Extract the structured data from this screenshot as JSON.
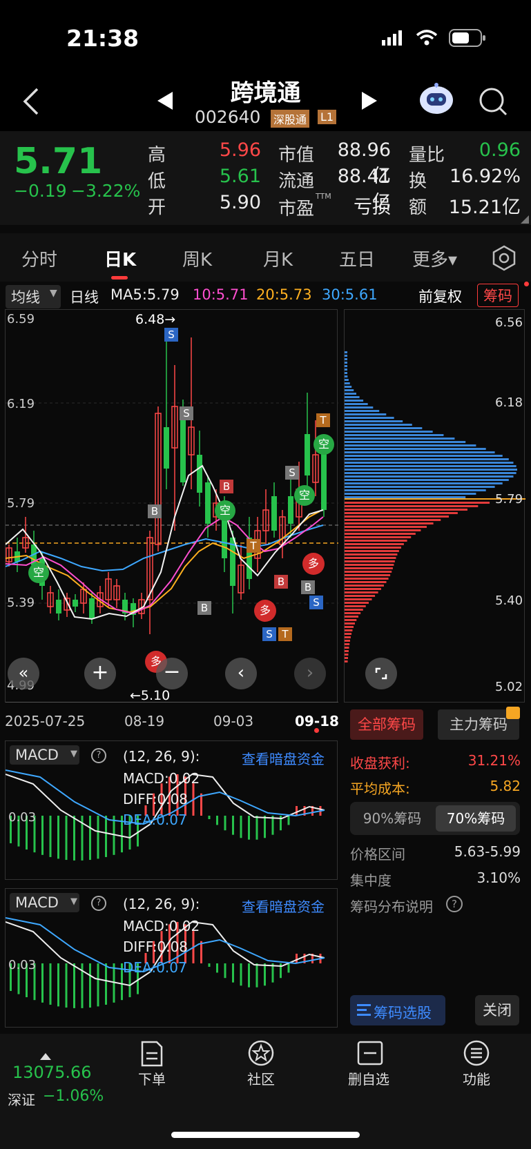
{
  "status": {
    "time": "21:38"
  },
  "stock": {
    "name": "跨境通",
    "code": "002640",
    "market_tag": "深股通",
    "level_tag": "L1"
  },
  "quote": {
    "price": "5.71",
    "change": "−0.19",
    "change_pct": "−3.22%",
    "high_label": "高",
    "high": "5.96",
    "low_label": "低",
    "low": "5.61",
    "open_label": "开",
    "open": "5.90",
    "mcap_label": "市值",
    "mcap": "88.96亿",
    "float_label": "流通",
    "float": "88.41亿",
    "pe_label": "市盈",
    "pe_sup": "TTM",
    "pe": "亏损",
    "vr_label": "量比",
    "vr": "0.96",
    "turn_label": "换",
    "turn": "16.92%",
    "amt_label": "额",
    "amt": "15.21亿"
  },
  "tabs": [
    "分时",
    "日K",
    "周K",
    "月K",
    "五日",
    "更多▾"
  ],
  "ma": {
    "selector": "均线",
    "period": "日线",
    "ma5": "MA5:5.79",
    "ma10": "10:5.71",
    "ma20": "20:5.73",
    "ma30": "30:5.61",
    "adjust": "前复权",
    "chips_btn": "筹码"
  },
  "kchart": {
    "y_labels": [
      "6.59",
      "6.19",
      "5.79",
      "5.39",
      "4.99"
    ],
    "high_note": "6.48→",
    "low_note": "←5.10",
    "dates": [
      "2025-07-25",
      "08-19",
      "09-03",
      "09-18"
    ]
  },
  "chips": {
    "y_labels": [
      "6.56",
      "6.18",
      "5.79",
      "5.40",
      "5.02"
    ],
    "tab_all": "全部筹码",
    "tab_main": "主力筹码",
    "profit_label": "收盘获利:",
    "profit": "31.21%",
    "avg_label": "平均成本:",
    "avg": "5.82",
    "seg_90": "90%筹码",
    "seg_70": "70%筹码",
    "range_label": "价格区间",
    "range": "5.63-5.99",
    "conc_label": "集中度",
    "conc": "3.10%",
    "explain": "筹码分布说明",
    "select_btn": "筹码选股",
    "close_btn": "关闭"
  },
  "macd": {
    "name": "MACD",
    "params": "(12, 26, 9):",
    "link": "查看暗盘资金",
    "macd": "MACD:0.02",
    "diff": "DIFF:0.08",
    "dea": "DEA:0.07",
    "axis": "0.03"
  },
  "bottom": {
    "index": "13075.66",
    "index_name": "深证",
    "index_chg": "−1.06%",
    "order": "下单",
    "community": "社区",
    "unwatch": "删自选",
    "func": "功能"
  },
  "colors": {
    "up": "#ff4848",
    "down": "#27c24c",
    "accent": "#ff4848",
    "blue": "#3ea8ff",
    "orange": "#f5a623"
  }
}
